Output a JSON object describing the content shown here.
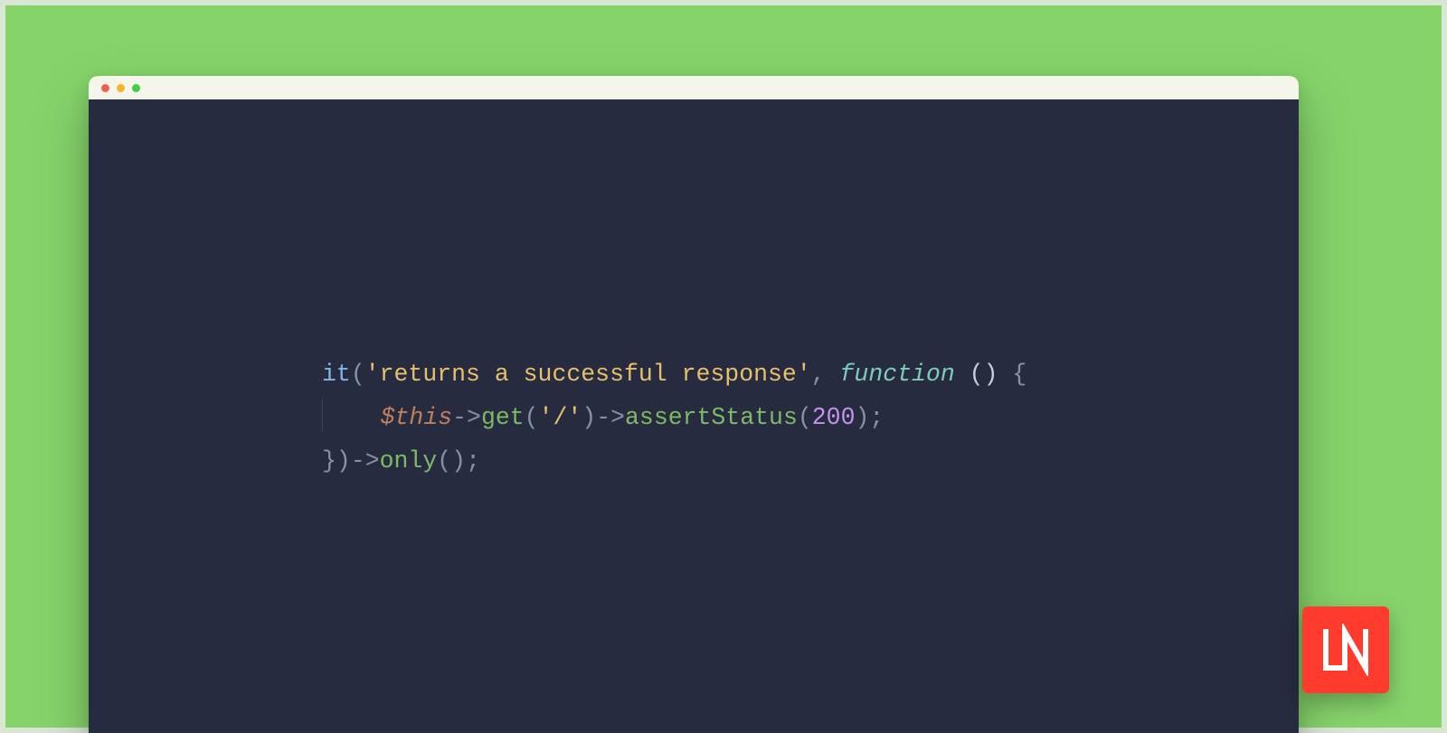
{
  "colors": {
    "stage_bg": "#86d36b",
    "frame_border": "#d9e6d4",
    "titlebar_bg": "#f3f6e8",
    "editor_bg": "#262b3f",
    "badge_bg": "#ff3b2d"
  },
  "window": {
    "traffic_lights": [
      "red",
      "yellow",
      "green"
    ]
  },
  "code": {
    "line1": {
      "fn": "it",
      "open_paren": "(",
      "string_quote_open": "'",
      "string_text": "returns a successful response",
      "string_quote_close": "'",
      "comma_sp": ", ",
      "keyword": "function",
      "fn_parens": " () ",
      "brace_open": "{"
    },
    "line2": {
      "indent": "    ",
      "this": "$this",
      "arrow1": "->",
      "m_get": "get",
      "get_open": "(",
      "get_arg_q1": "'",
      "get_arg": "/",
      "get_arg_q2": "'",
      "get_close": ")",
      "arrow2": "->",
      "m_assert": "assertStatus",
      "as_open": "(",
      "as_arg": "200",
      "as_close": ")",
      "semi": ";"
    },
    "line3": {
      "brace_close": "}",
      "close_paren": ")",
      "arrow": "->",
      "m_only": "only",
      "only_parens": "()",
      "semi": ";"
    }
  },
  "badge": {
    "text": "LN"
  }
}
